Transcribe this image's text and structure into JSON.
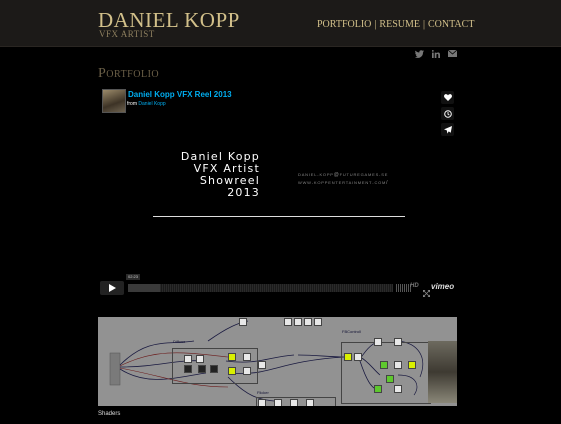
{
  "site": {
    "name": "DANIEL KOPP",
    "subtitle": "VFX ARTIST"
  },
  "nav": {
    "items": [
      "PORTFOLIO",
      "RESUME",
      "CONTACT"
    ],
    "separator": "|"
  },
  "social": [
    "twitter-icon",
    "linkedin-icon",
    "mail-icon"
  ],
  "page": {
    "title": "Portfolio"
  },
  "video": {
    "title": "Daniel Kopp VFX Reel 2013",
    "from_label": "from",
    "author": "Daniel Kopp",
    "reel_lines": [
      "Daniel Kopp",
      "VFX Artist",
      "Showreel",
      "2013"
    ],
    "contact_lines": [
      "daniel.kopp@futuregames.se",
      "www.koppentertainment.com/"
    ],
    "timecode": "02:23",
    "hd_label": "HD",
    "brand": "vimeo",
    "played_fraction": 0.0,
    "loaded_fraction": 0.12
  },
  "graph": {
    "labels": [
      "Diffuse",
      "FBControll",
      "Flicker"
    ]
  },
  "caption": "Shaders",
  "colors": {
    "accent": "#d2c08a",
    "vimeo_blue": "#00adef",
    "header_bg": "#1c1a18"
  }
}
